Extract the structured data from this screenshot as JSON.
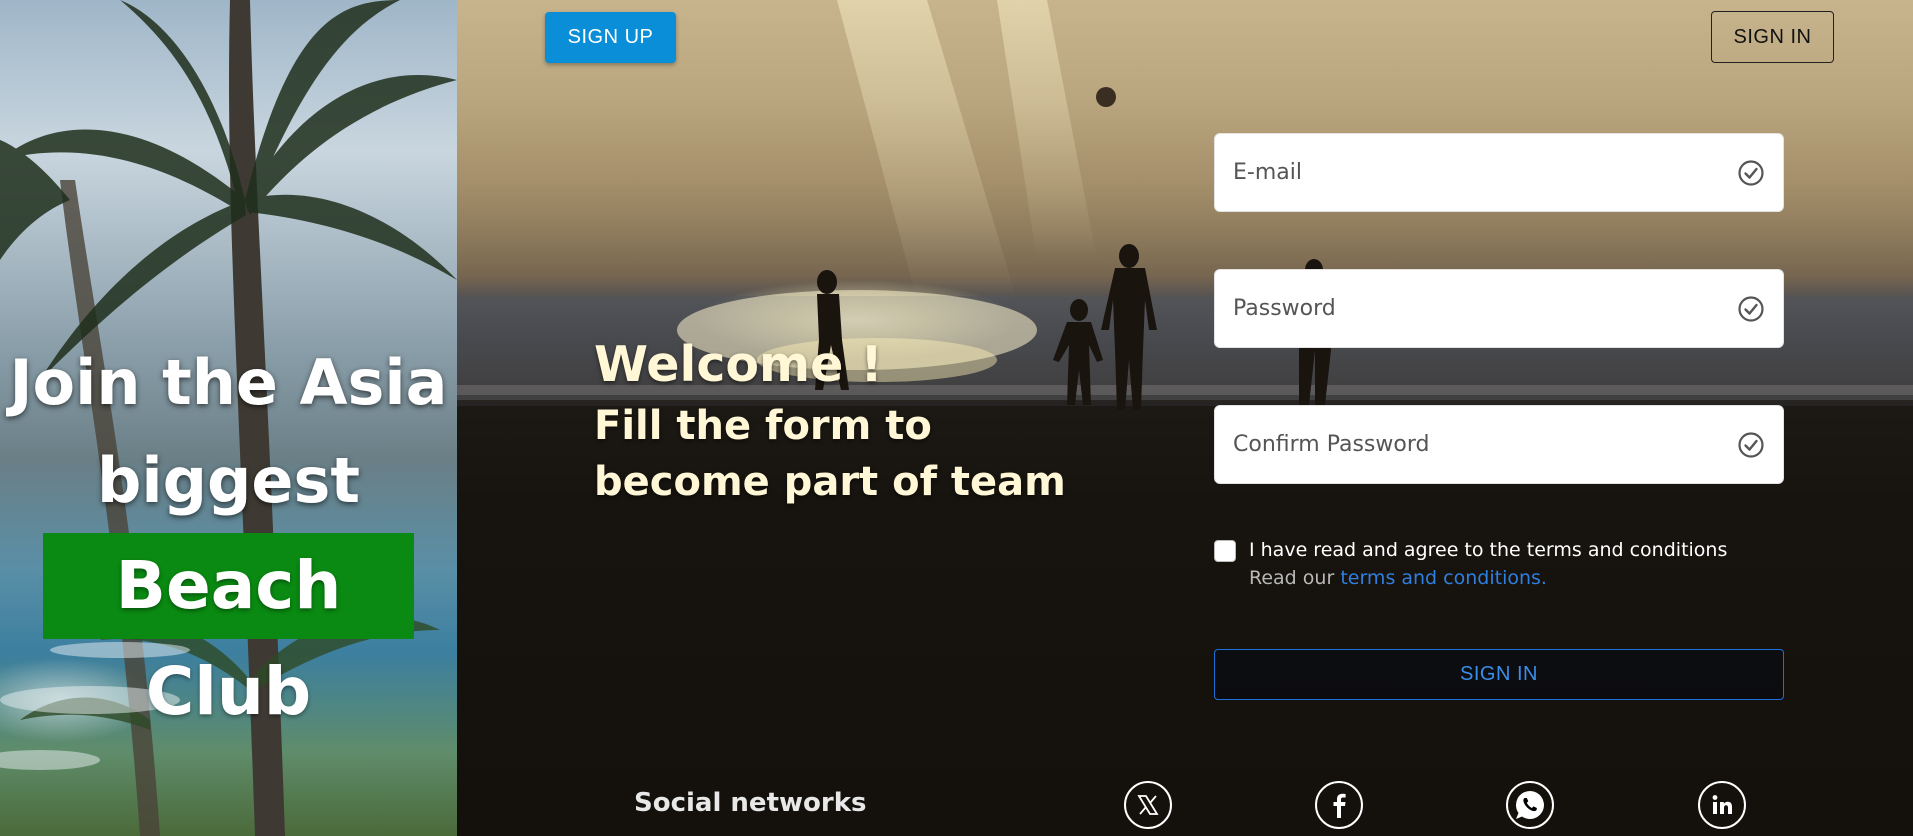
{
  "hero": {
    "line1": "Join the Asia",
    "line2": "biggest",
    "highlight": "Beach Club"
  },
  "header": {
    "signup_label": "SIGN UP",
    "signin_label": "SIGN IN"
  },
  "intro": {
    "welcome": "Welcome !",
    "tagline": "Fill the form to become part of team"
  },
  "form": {
    "email_placeholder": "E-mail",
    "password_placeholder": "Password",
    "confirm_placeholder": "Confirm Password",
    "terms_label": "I have read and agree to the terms and conditions",
    "terms_hint_prefix": "Read our ",
    "terms_link": "terms and conditions.",
    "submit_label": "SIGN IN"
  },
  "social": {
    "title": "Social networks",
    "icons": [
      "x-icon",
      "facebook-icon",
      "whatsapp-icon",
      "linkedin-icon"
    ]
  },
  "colors": {
    "signup_button": "#0a8ed8",
    "highlight_bg": "#0a8a12",
    "link": "#2f7fe0",
    "submit_border": "#1e6fd8"
  }
}
